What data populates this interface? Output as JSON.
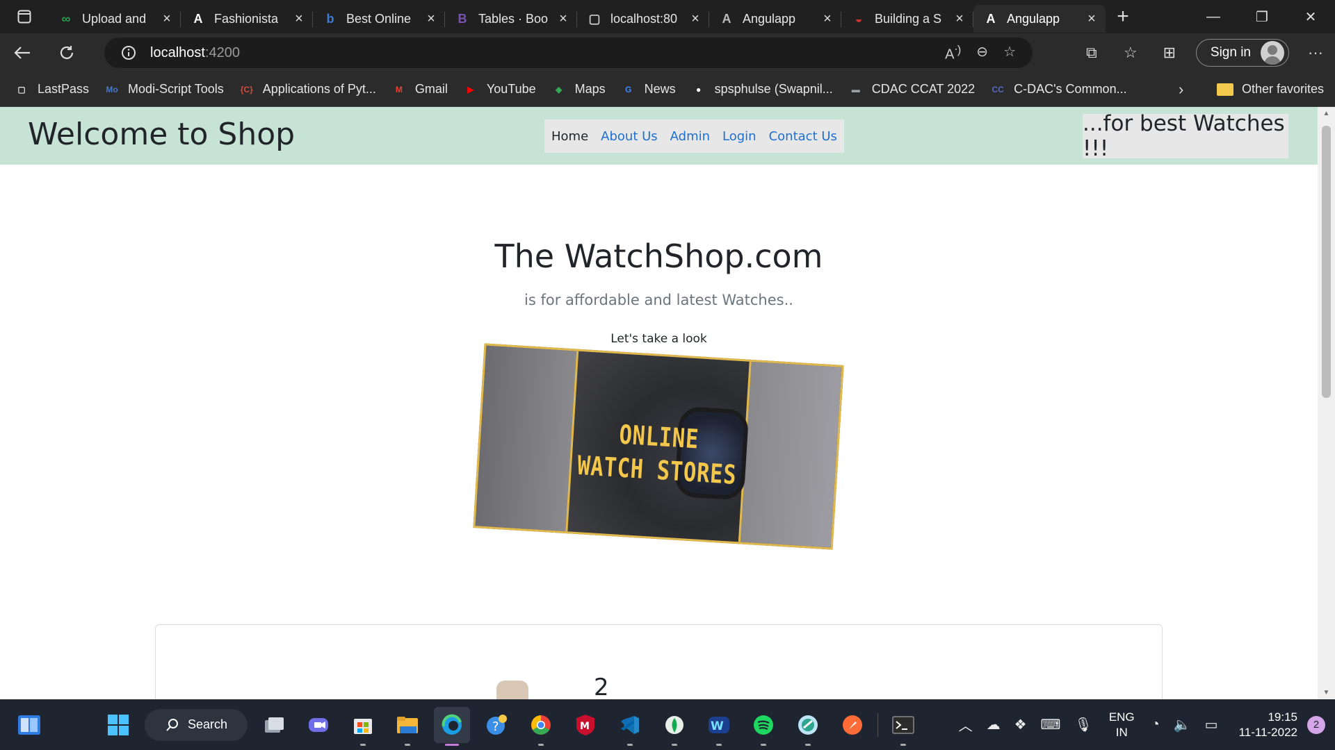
{
  "browser": {
    "tabs": [
      {
        "title": "Upload and",
        "fav": "∞",
        "fav_color": "#2e9e4f"
      },
      {
        "title": "Fashionista",
        "fav": "A",
        "fav_color": "#ffffff"
      },
      {
        "title": "Best Online",
        "fav": "b",
        "fav_color": "#3c7bd6"
      },
      {
        "title": "Tables · Boo",
        "fav": "B",
        "fav_color": "#7952b3"
      },
      {
        "title": "localhost:80",
        "fav": "▢",
        "fav_color": "#cccccc"
      },
      {
        "title": "Angulapp",
        "fav": "A",
        "fav_color": "#bbbbbb"
      },
      {
        "title": "Building a S",
        "fav": "◒",
        "fav_color": "#d0312d"
      },
      {
        "title": "Angulapp",
        "fav": "A",
        "fav_color": "#ffffff"
      }
    ],
    "address": {
      "host": "localhost",
      "port": ":4200"
    },
    "sign_in_label": "Sign in",
    "bookmarks": [
      {
        "label": "LastPass",
        "icon": "▢",
        "color": "#e6e6e6"
      },
      {
        "label": "Modi-Script Tools",
        "icon": "Mo",
        "color": "#4a79c9"
      },
      {
        "label": "Applications of Pyt...",
        "icon": "{C}",
        "color": "#d64a3b"
      },
      {
        "label": "Gmail",
        "icon": "M",
        "color": "#ea4335"
      },
      {
        "label": "YouTube",
        "icon": "▶",
        "color": "#ff0000"
      },
      {
        "label": "Maps",
        "icon": "◆",
        "color": "#34a853"
      },
      {
        "label": "News",
        "icon": "G",
        "color": "#4285f4"
      },
      {
        "label": "spsphulse (Swapnil...",
        "icon": "●",
        "color": "#ffffff"
      },
      {
        "label": "CDAC CCAT 2022",
        "icon": "▬",
        "color": "#9aa0a6"
      },
      {
        "label": "C-DAC's Common...",
        "icon": "CC",
        "color": "#5a6abf"
      }
    ],
    "other_favorites": "Other favorites"
  },
  "site": {
    "brand": "Welcome to Shop",
    "nav": {
      "home": "Home",
      "about": "About Us",
      "admin": "Admin",
      "login": "Login",
      "contact": "Contact Us"
    },
    "slogan": "...for best Watches !!!",
    "hero_title": "The WatchShop.com",
    "hero_subtitle": "is for affordable and latest Watches..",
    "hero_look": "Let's take a look",
    "banner_line1": "ONLINE",
    "banner_line2": "WATCH STORES",
    "card_number": "2"
  },
  "taskbar": {
    "search_label": "Search",
    "lang_line1": "ENG",
    "lang_line2": "IN",
    "time": "19:15",
    "date": "11-11-2022",
    "notifications": "2"
  }
}
